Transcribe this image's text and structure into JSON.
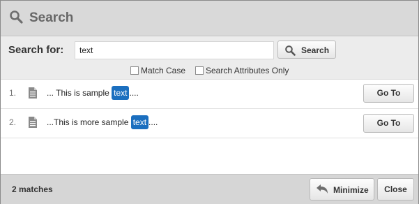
{
  "title": "Search",
  "title_icon": "search-icon",
  "search": {
    "label": "Search for:",
    "value": "text",
    "placeholder": "",
    "button_label": "Search",
    "button_icon": "search-icon"
  },
  "options": [
    {
      "label": "Match Case",
      "checked": false
    },
    {
      "label": "Search Attributes Only",
      "checked": false
    }
  ],
  "results": [
    {
      "number": "1.",
      "icon": "document-icon",
      "before": "... This is sample ",
      "match": "text",
      "after": "....",
      "action": "Go To"
    },
    {
      "number": "2.",
      "icon": "document-icon",
      "before": "...This is more sample ",
      "match": "text",
      "after": "....",
      "action": "Go To"
    }
  ],
  "footer": {
    "count": "2 matches",
    "minimize_label": "Minimize",
    "minimize_icon": "undo-arrow-icon",
    "close_label": "Close"
  },
  "colors": {
    "highlight": "#1b6fbf",
    "title_bar": "#d9d9d9",
    "search_bar": "#ececec",
    "footer": "#d6d6d6"
  }
}
